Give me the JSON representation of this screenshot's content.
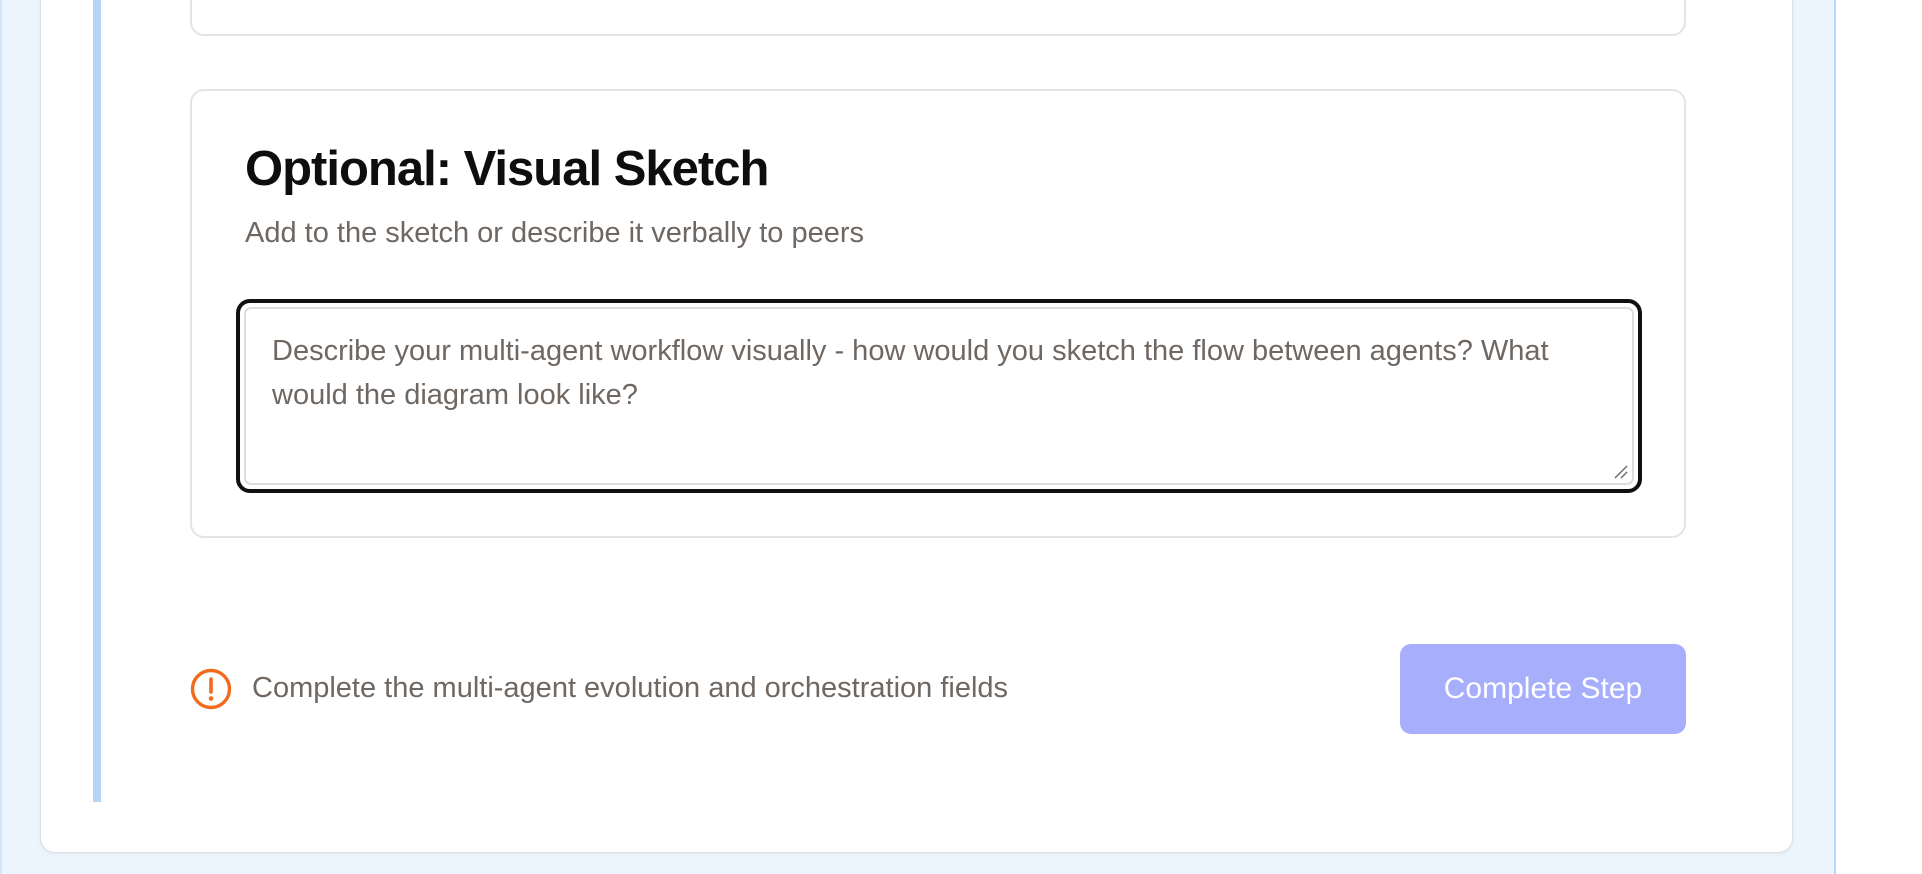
{
  "sketch_section": {
    "title": "Optional: Visual Sketch",
    "subtitle": "Add to the sketch or describe it verbally to peers",
    "textarea": {
      "value": "",
      "placeholder": "Describe your multi-agent workflow visually - how would you sketch the flow between agents? What would the diagram look like?"
    }
  },
  "footer": {
    "warning_icon": "alert-circle-icon",
    "warning_message": "Complete the multi-agent evolution and orchestration fields",
    "complete_button_label": "Complete Step",
    "complete_button_disabled": true
  },
  "colors": {
    "page_background": "#ecf4fd",
    "accent_bar": "#b6d6f6",
    "warning": "#f26b1d",
    "button_disabled": "#a7aefb",
    "muted_text": "#6f6762"
  }
}
